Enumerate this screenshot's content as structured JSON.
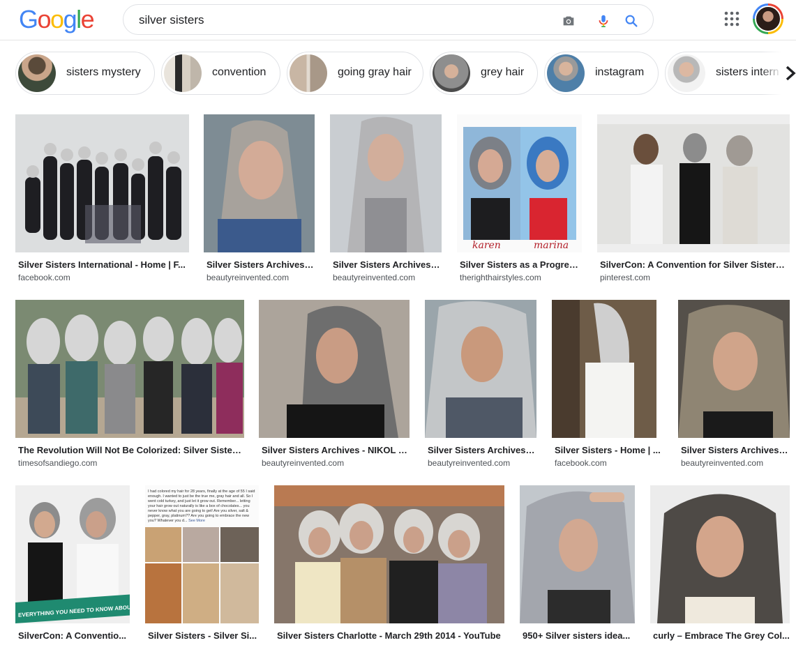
{
  "header": {
    "logo_letters": [
      {
        "ch": "G",
        "color": "#4285f4"
      },
      {
        "ch": "o",
        "color": "#ea4335"
      },
      {
        "ch": "o",
        "color": "#fbbc05"
      },
      {
        "ch": "g",
        "color": "#4285f4"
      },
      {
        "ch": "l",
        "color": "#34a853"
      },
      {
        "ch": "e",
        "color": "#ea4335"
      }
    ],
    "search_value": "silver sisters",
    "icons": [
      "camera-icon",
      "microphone-icon",
      "search-icon",
      "apps-grid-icon",
      "account-avatar"
    ]
  },
  "chips": [
    {
      "label": "sisters mystery"
    },
    {
      "label": "convention"
    },
    {
      "label": "going gray hair"
    },
    {
      "label": "grey hair"
    },
    {
      "label": "instagram"
    },
    {
      "label": "sisters intern"
    }
  ],
  "results": [
    {
      "title": "Silver Sisters International - Home | F...",
      "source": "facebook.com"
    },
    {
      "title": "Silver Sisters Archives ...",
      "source": "beautyreinvented.com"
    },
    {
      "title": "Silver Sisters Archives ...",
      "source": "beautyreinvented.com"
    },
    {
      "title": "Silver Sisters as a Progress...",
      "source": "therighthairstyles.com"
    },
    {
      "title": "SilverCon: A Convention for Silver Sisters ...",
      "source": "pinterest.com"
    },
    {
      "title": "The Revolution Will Not Be Colorized: Silver Sister...",
      "source": "timesofsandiego.com"
    },
    {
      "title": "Silver Sisters Archives - NIKOL J...",
      "source": "beautyreinvented.com"
    },
    {
      "title": "Silver Sisters Archives ...",
      "source": "beautyreinvented.com"
    },
    {
      "title": "Silver Sisters - Home | ...",
      "source": "facebook.com"
    },
    {
      "title": "Silver Sisters Archives ...",
      "source": "beautyreinvented.com"
    },
    {
      "title": "SilverCon: A Conventio...",
      "source": ""
    },
    {
      "title": "Silver Sisters - Silver Si...",
      "source": ""
    },
    {
      "title": "Silver Sisters Charlotte - March 29th 2014 - YouTube",
      "source": ""
    },
    {
      "title": "950+ Silver sisters idea...",
      "source": ""
    },
    {
      "title": "curly – Embrace The Grey Col...",
      "source": ""
    }
  ],
  "image_text": {
    "banner": "EVERYTHING YOU NEED TO KNOW ABOUT",
    "karen": "karen",
    "marina": "marina",
    "post_text": "I had colored my hair for 28 years, finally at the age of 55 I said enough. I wanted to just be the true me, gray hair and all. So I went cold turkey, and just let it grow out. Remember... letting your hair grow out naturally is like a box of chocolates... you never know what you are going to get! Are you silver, salt & pepper, gray, platinum?? Are you going to embrace the new you? Whatever you d...",
    "see_more": "See More"
  }
}
